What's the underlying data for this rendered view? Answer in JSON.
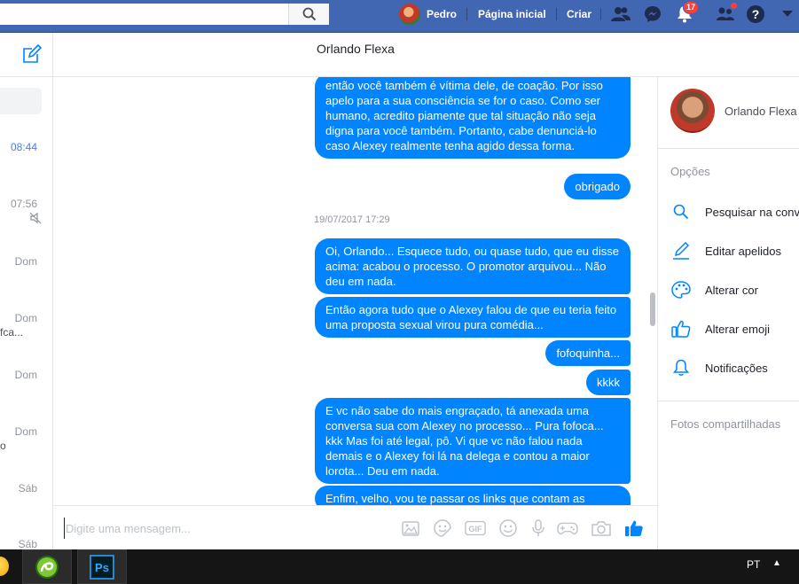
{
  "topbar": {
    "search_placeholder": "",
    "user_name": "Pedro",
    "home_label": "Página inicial",
    "create_label": "Criar",
    "notifications_count": "17",
    "brand_color": "#4267b2"
  },
  "left_panel": {
    "times": [
      "08:44",
      "07:56",
      "Dom",
      "Dom",
      "Dom",
      "Dom",
      "Sáb",
      "Sáb"
    ],
    "fragments": [
      "fca...",
      "o"
    ]
  },
  "conversation": {
    "title": "Orlando Flexa",
    "date_separator": "19/07/2017 17:29",
    "messages": [
      "então você também é vítima dele, de coação. Por isso apelo para a sua consciência se for o caso. Como ser humano, acredito piamente que tal situação não seja digna para você também. Portanto, cabe denunciá-lo caso Alexey realmente tenha agido dessa forma.",
      "obrigado",
      "Oi, Orlando... Esquece tudo, ou quase tudo, que eu disse acima: acabou o processo. O promotor arquivou... Não deu em nada.",
      "Então agora tudo que o Alexey falou de que eu teria feito uma proposta sexual virou pura comédia...",
      "fofoquinha...",
      "kkkk",
      "E vc não sabe do mais engraçado, tá anexada uma conversa sua com Alexey no processo... Pura fofoca... kkk Mas foi até legal, pô. Vi que vc não falou nada demais e o Alexey foi lá na delega e contou a maior lorota... Deu em nada.",
      "Enfim, velho, vou te passar os links que contam as"
    ],
    "bubble_color": "#0084ff"
  },
  "composer": {
    "placeholder": "Digite uma mensagem..."
  },
  "right_panel": {
    "name": "Orlando Flexa",
    "options_header": "Opções",
    "options": [
      "Pesquisar na conversa",
      "Editar apelidos",
      "Alterar cor",
      "Alterar emoji",
      "Notificações"
    ],
    "shared_photos_header": "Fotos compartilhadas"
  },
  "taskbar": {
    "language": "PT"
  }
}
